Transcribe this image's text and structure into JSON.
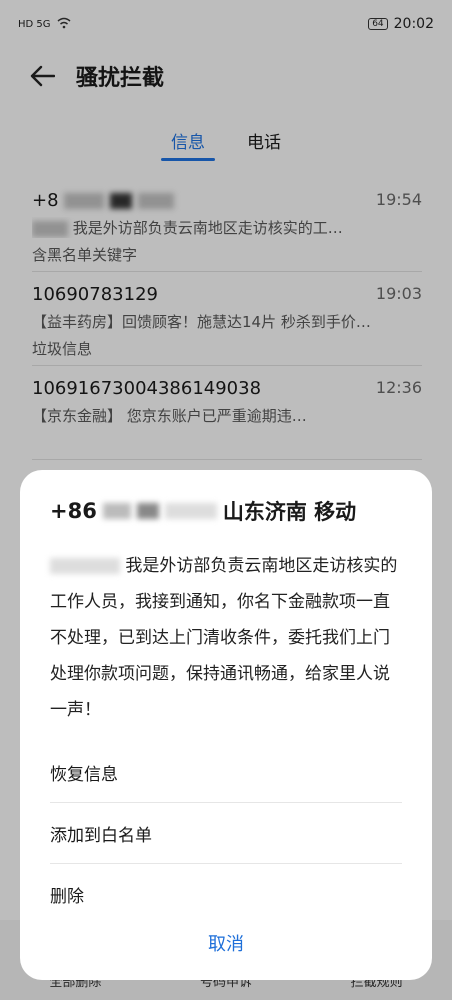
{
  "status": {
    "left": "HD 5G",
    "battery": "64",
    "time": "20:02"
  },
  "header": {
    "title": "骚扰拦截"
  },
  "tabs": [
    {
      "label": "信息"
    },
    {
      "label": "电话"
    }
  ],
  "messages": [
    {
      "sender": "+8",
      "time": "19:54",
      "snippet": "我是外访部负责云南地区走访核实的工…",
      "tag": "含黑名单关键字"
    },
    {
      "sender": "10690783129",
      "time": "19:03",
      "snippet": "【益丰药房】回馈顾客！施慧达14片 秒杀到手价…",
      "tag": "垃圾信息"
    },
    {
      "sender": "10691673004386149038",
      "time": "12:36",
      "snippet": "【京东金融】 您京东账户已严重逾期违…",
      "tag": ""
    }
  ],
  "bottom_bar": {
    "items": [
      "全部删除",
      "号码申诉",
      "拦截规则"
    ]
  },
  "sheet": {
    "title_prefix": "+86",
    "title_suffix": "山东济南 移动",
    "body": "我是外访部负责云南地区走访核实的工作人员，我接到通知，你名下金融款项一直不处理，已到达上门清收条件，委托我们上门处理你款项问题，保持通讯畅通，给家里人说一声！",
    "options": [
      "恢复信息",
      "添加到白名单",
      "删除"
    ],
    "cancel": "取消"
  }
}
